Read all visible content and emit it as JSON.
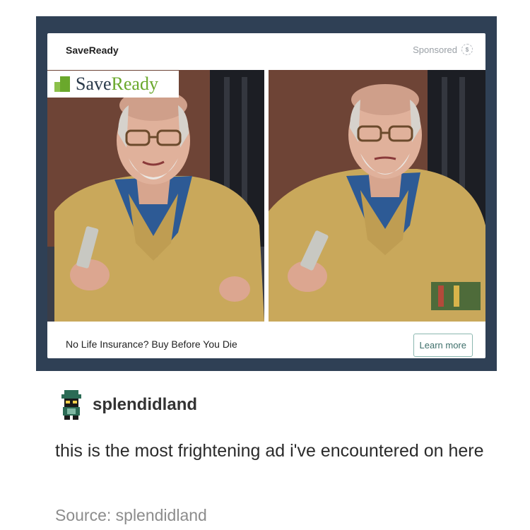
{
  "ad": {
    "advertiser": "SaveReady",
    "sponsored_label": "Sponsored",
    "sponsored_icon": "dollar-icon",
    "brand_logo_text_a": "Save",
    "brand_logo_text_b": "Ready",
    "caption": "No Life Insurance? Buy Before You Die",
    "cta_label": "Learn more"
  },
  "post": {
    "username": "splendidland",
    "text": "this is the most frightening ad i've encountered on here",
    "source": "Source: splendidland"
  },
  "colors": {
    "frame_bg": "#2f4055",
    "brand_green": "#6aa82c",
    "cta_border": "#8bb7b0"
  }
}
